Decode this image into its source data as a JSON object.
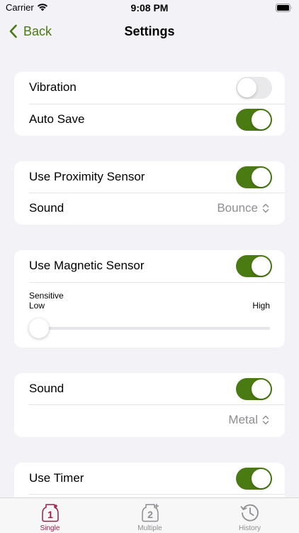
{
  "status_bar": {
    "carrier": "Carrier",
    "time": "9:08 PM"
  },
  "nav": {
    "back_label": "Back",
    "title": "Settings"
  },
  "section_general": {
    "vibration": {
      "label": "Vibration",
      "on": false
    },
    "auto_save": {
      "label": "Auto Save",
      "on": true
    }
  },
  "section_proximity": {
    "use_proximity": {
      "label": "Use Proximity Sensor",
      "on": true
    },
    "sound": {
      "label": "Sound",
      "value": "Bounce"
    }
  },
  "section_magnetic": {
    "use_magnetic": {
      "label": "Use Magnetic Sensor",
      "on": true
    },
    "sensitive": {
      "label": "Sensitive",
      "low_label": "Low",
      "high_label": "High",
      "value_fraction": 0.0
    }
  },
  "section_sound": {
    "sound": {
      "label": "Sound",
      "on": true
    },
    "picker_value": "Metal"
  },
  "section_timer": {
    "use_timer": {
      "label": "Use Timer",
      "on": true
    }
  },
  "tabs": [
    {
      "label": "Single",
      "icon": "single-counter-icon",
      "active": true
    },
    {
      "label": "Multiple",
      "icon": "multiple-counter-icon",
      "active": false
    },
    {
      "label": "History",
      "icon": "history-icon",
      "active": false
    }
  ],
  "colors": {
    "accent": "#4a7a12",
    "tab_active": "#9c1f48",
    "inactive": "#8e8e93",
    "background": "#f2f2f7"
  }
}
